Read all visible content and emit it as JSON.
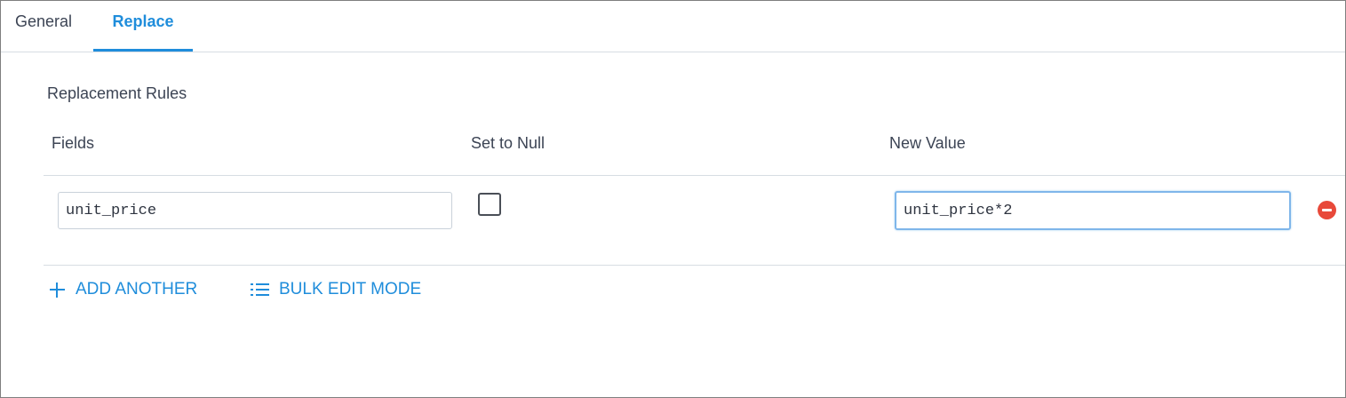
{
  "tabs": [
    {
      "label": "General",
      "active": false
    },
    {
      "label": "Replace",
      "active": true
    }
  ],
  "section": {
    "title": "Replacement Rules"
  },
  "columns": {
    "fields": "Fields",
    "set_to_null": "Set to Null",
    "new_value": "New Value"
  },
  "rules": [
    {
      "field": "unit_price",
      "set_to_null": false,
      "new_value": "unit_price*2"
    }
  ],
  "actions": {
    "add_another": "ADD ANOTHER",
    "bulk_edit": "BULK EDIT MODE"
  },
  "icons": {
    "add": "plus-icon",
    "bulk": "list-icon",
    "remove": "remove-circle-icon"
  },
  "colors": {
    "accent": "#1f8ddb",
    "remove": "#e8493a",
    "text": "#3c4454",
    "divider": "#d7dde3"
  }
}
